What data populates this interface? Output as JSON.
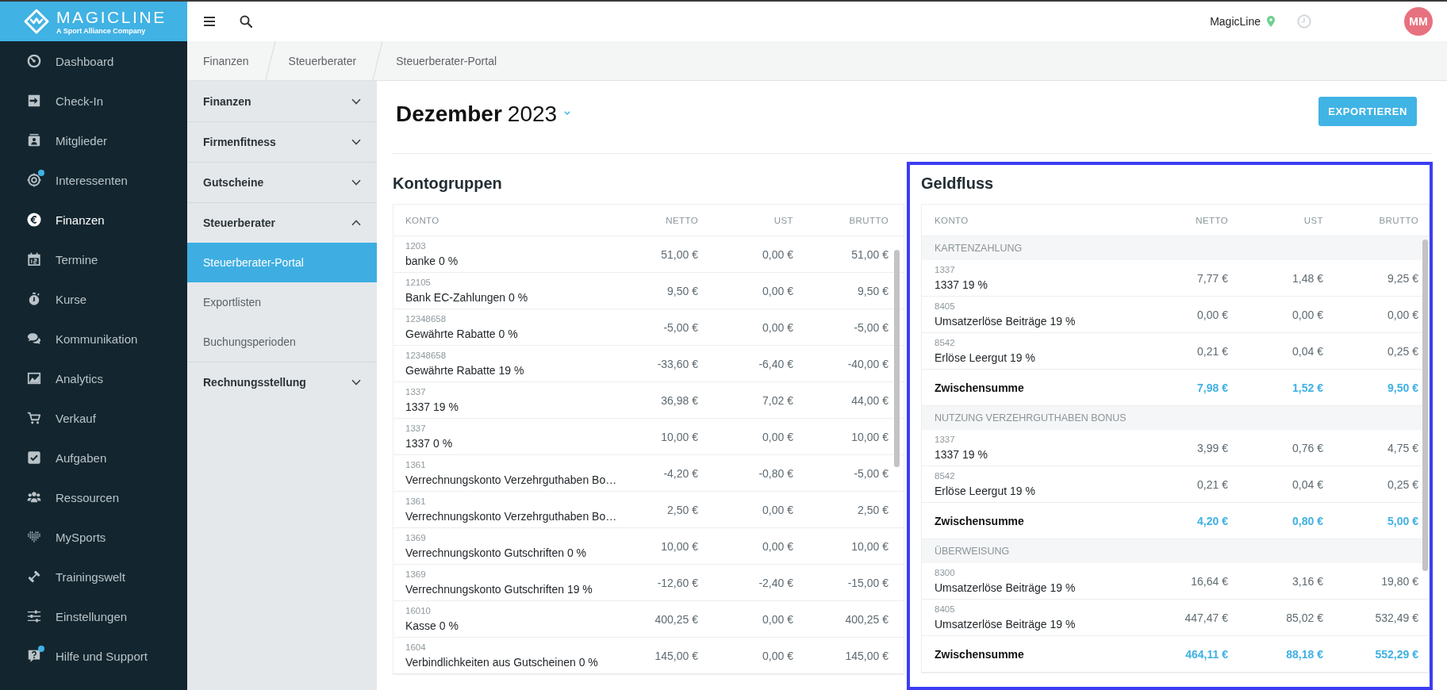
{
  "logo": {
    "name": "MAGICLINE",
    "tagline": "A Sport Alliance Company"
  },
  "sidebar": {
    "items": [
      {
        "label": "Dashboard",
        "selected": false,
        "notification": false
      },
      {
        "label": "Check-In",
        "selected": false,
        "notification": false
      },
      {
        "label": "Mitglieder",
        "selected": false,
        "notification": false
      },
      {
        "label": "Interessenten",
        "selected": false,
        "notification": true
      },
      {
        "label": "Finanzen",
        "selected": true,
        "notification": false
      },
      {
        "label": "Termine",
        "selected": false,
        "notification": false
      },
      {
        "label": "Kurse",
        "selected": false,
        "notification": false
      },
      {
        "label": "Kommunikation",
        "selected": false,
        "notification": false
      },
      {
        "label": "Analytics",
        "selected": false,
        "notification": false
      },
      {
        "label": "Verkauf",
        "selected": false,
        "notification": false
      },
      {
        "label": "Aufgaben",
        "selected": false,
        "notification": false
      },
      {
        "label": "Ressourcen",
        "selected": false,
        "notification": false
      },
      {
        "label": "MySports",
        "selected": false,
        "notification": false
      },
      {
        "label": "Trainingswelt",
        "selected": false,
        "notification": false
      },
      {
        "label": "Einstellungen",
        "selected": false,
        "notification": false
      },
      {
        "label": "Hilfe und Support",
        "selected": false,
        "notification": true
      }
    ]
  },
  "topbar": {
    "location": "MagicLine",
    "avatar": "MM"
  },
  "breadcrumb": [
    "Finanzen",
    "Steuerberater",
    "Steuerberater-Portal"
  ],
  "subnav": [
    {
      "label": "Finanzen",
      "expanded": false
    },
    {
      "label": "Firmenfitness",
      "expanded": false
    },
    {
      "label": "Gutscheine",
      "expanded": false
    },
    {
      "label": "Steuerberater",
      "expanded": true,
      "children": [
        {
          "label": "Steuerberater-Portal",
          "selected": true
        },
        {
          "label": "Exportlisten",
          "selected": false
        },
        {
          "label": "Buchungsperioden",
          "selected": false
        }
      ]
    },
    {
      "label": "Rechnungsstellung",
      "expanded": false
    }
  ],
  "period": {
    "month": "Dezember",
    "year": "2023"
  },
  "export_button": "EXPORTIEREN",
  "kontogruppen": {
    "title": "Kontogruppen",
    "columns": [
      "KONTO",
      "NETTO",
      "UST",
      "BRUTTO"
    ],
    "rows": [
      {
        "number": "1203",
        "name": "banke 0 %",
        "netto": "51,00 €",
        "ust": "0,00 €",
        "brutto": "51,00 €"
      },
      {
        "number": "12105",
        "name": "Bank EC-Zahlungen 0 %",
        "netto": "9,50 €",
        "ust": "0,00 €",
        "brutto": "9,50 €"
      },
      {
        "number": "12348658",
        "name": "Gewährte Rabatte 0 %",
        "netto": "-5,00 €",
        "ust": "0,00 €",
        "brutto": "-5,00 €"
      },
      {
        "number": "12348658",
        "name": "Gewährte Rabatte 19 %",
        "netto": "-33,60 €",
        "ust": "-6,40 €",
        "brutto": "-40,00 €"
      },
      {
        "number": "1337",
        "name": "1337 19 %",
        "netto": "36,98 €",
        "ust": "7,02 €",
        "brutto": "44,00 €"
      },
      {
        "number": "1337",
        "name": "1337 0 %",
        "netto": "10,00 €",
        "ust": "0,00 €",
        "brutto": "10,00 €"
      },
      {
        "number": "1361",
        "name": "Verrechnungskonto Verzehrguthaben Bo…",
        "netto": "-4,20 €",
        "ust": "-0,80 €",
        "brutto": "-5,00 €"
      },
      {
        "number": "1361",
        "name": "Verrechnungskonto Verzehrguthaben Bo…",
        "netto": "2,50 €",
        "ust": "0,00 €",
        "brutto": "2,50 €"
      },
      {
        "number": "1369",
        "name": "Verrechnungskonto Gutschriften 0 %",
        "netto": "10,00 €",
        "ust": "0,00 €",
        "brutto": "10,00 €"
      },
      {
        "number": "1369",
        "name": "Verrechnungskonto Gutschriften 19 %",
        "netto": "-12,60 €",
        "ust": "-2,40 €",
        "brutto": "-15,00 €"
      },
      {
        "number": "16010",
        "name": "Kasse 0 %",
        "netto": "400,25 €",
        "ust": "0,00 €",
        "brutto": "400,25 €"
      },
      {
        "number": "1604",
        "name": "Verbindlichkeiten aus Gutscheinen 0 %",
        "netto": "145,00 €",
        "ust": "0,00 €",
        "brutto": "145,00 €"
      }
    ]
  },
  "geldfluss": {
    "title": "Geldfluss",
    "highlighted": true,
    "columns": [
      "KONTO",
      "NETTO",
      "UST",
      "BRUTTO"
    ],
    "rows": [
      {
        "kind": "group",
        "label": "KARTENZAHLUNG"
      },
      {
        "kind": "account",
        "number": "1337",
        "name": "1337 19 %",
        "netto": "7,77 €",
        "ust": "1,48 €",
        "brutto": "9,25 €"
      },
      {
        "kind": "account",
        "number": "8405",
        "name": "Umsatzerlöse Beiträge 19 %",
        "netto": "0,00 €",
        "ust": "0,00 €",
        "brutto": "0,00 €"
      },
      {
        "kind": "account",
        "number": "8542",
        "name": "Erlöse Leergut 19 %",
        "netto": "0,21 €",
        "ust": "0,04 €",
        "brutto": "0,25 €"
      },
      {
        "kind": "subtotal",
        "label": "Zwischensumme",
        "netto": "7,98 €",
        "ust": "1,52 €",
        "brutto": "9,50 €"
      },
      {
        "kind": "group",
        "label": "NUTZUNG VERZEHRGUTHABEN BONUS"
      },
      {
        "kind": "account",
        "number": "1337",
        "name": "1337 19 %",
        "netto": "3,99 €",
        "ust": "0,76 €",
        "brutto": "4,75 €"
      },
      {
        "kind": "account",
        "number": "8542",
        "name": "Erlöse Leergut 19 %",
        "netto": "0,21 €",
        "ust": "0,04 €",
        "brutto": "0,25 €"
      },
      {
        "kind": "subtotal",
        "label": "Zwischensumme",
        "netto": "4,20 €",
        "ust": "0,80 €",
        "brutto": "5,00 €"
      },
      {
        "kind": "group",
        "label": "ÜBERWEISUNG"
      },
      {
        "kind": "account",
        "number": "8300",
        "name": "Umsatzerlöse Beiträge 19 %",
        "netto": "16,64 €",
        "ust": "3,16 €",
        "brutto": "19,80 €"
      },
      {
        "kind": "account",
        "number": "8405",
        "name": "Umsatzerlöse Beiträge 19 %",
        "netto": "447,47 €",
        "ust": "85,02 €",
        "brutto": "532,49 €"
      },
      {
        "kind": "subtotal",
        "label": "Zwischensumme",
        "netto": "464,11 €",
        "ust": "88,18 €",
        "brutto": "552,29 €"
      }
    ]
  }
}
